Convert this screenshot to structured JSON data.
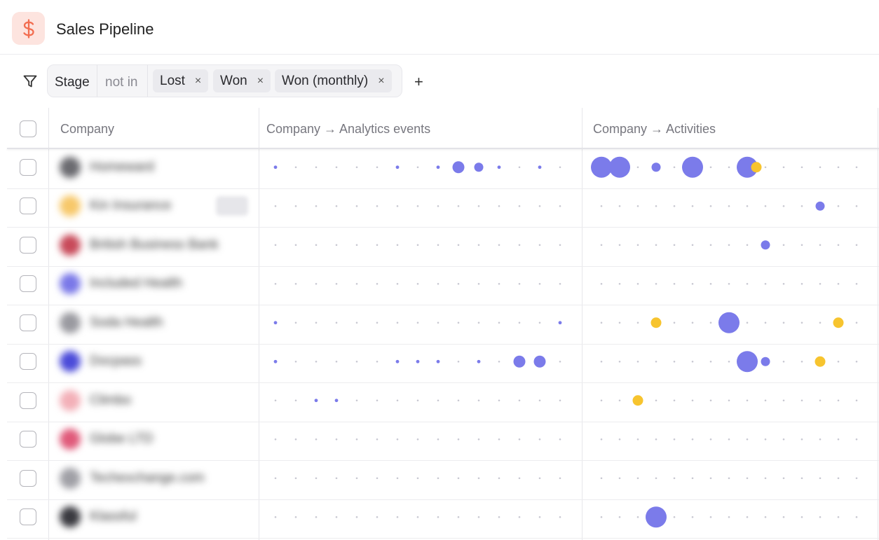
{
  "header": {
    "title": "Sales Pipeline",
    "icon": "dollar-icon",
    "icon_color": "#f26d50"
  },
  "filter": {
    "field": "Stage",
    "operator": "not in",
    "values": [
      "Lost",
      "Won",
      "Won (monthly)"
    ],
    "remove_glyph": "×",
    "add_glyph": "+"
  },
  "table": {
    "columns": [
      "Company",
      "Company → Analytics events",
      "Company → Activities"
    ],
    "rows": [
      {
        "company": "Homeward",
        "logo_color": "#6b6b70",
        "analytics": [
          1,
          0,
          0,
          0,
          0,
          0,
          1,
          0,
          1,
          3,
          2,
          1,
          0,
          1,
          0
        ],
        "activities": [
          {
            "i": 0,
            "s": 4
          },
          {
            "i": 1,
            "s": 4
          },
          {
            "i": 3,
            "s": 2
          },
          {
            "i": 5,
            "s": 4
          },
          {
            "i": 8,
            "s": 4
          },
          {
            "i": 8.5,
            "s": 2,
            "y": 1
          }
        ]
      },
      {
        "company": "Kin Insurance",
        "logo_color": "#f7c86a",
        "tag": true,
        "analytics": [
          0,
          0,
          0,
          0,
          0,
          0,
          0,
          0,
          0,
          0,
          0,
          0,
          0,
          0,
          0
        ],
        "activities": [
          {
            "i": 12,
            "s": 2
          }
        ]
      },
      {
        "company": "British Business Bank",
        "logo_color": "#c84a5a",
        "analytics": [
          0,
          0,
          0,
          0,
          0,
          0,
          0,
          0,
          0,
          0,
          0,
          0,
          0,
          0,
          0
        ],
        "activities": [
          {
            "i": 9,
            "s": 2
          }
        ]
      },
      {
        "company": "Included Health",
        "logo_color": "#7a78e8",
        "analytics": [
          0,
          0,
          0,
          0,
          0,
          0,
          0,
          0,
          0,
          0,
          0,
          0,
          0,
          0,
          0
        ],
        "activities": []
      },
      {
        "company": "Soda Health",
        "logo_color": "#9a9aa0",
        "analytics": [
          1,
          0,
          0,
          0,
          0,
          0,
          0,
          0,
          0,
          0,
          0,
          0,
          0,
          0,
          1
        ],
        "activities": [
          {
            "i": 3,
            "s": 2,
            "y": 1
          },
          {
            "i": 7,
            "s": 4
          },
          {
            "i": 13,
            "s": 2,
            "y": 1
          }
        ]
      },
      {
        "company": "Docpass",
        "logo_color": "#4b4bd9",
        "analytics": [
          1,
          0,
          0,
          0,
          0,
          0,
          1,
          1,
          1,
          0,
          1,
          0,
          3,
          3,
          0
        ],
        "activities": [
          {
            "i": 8,
            "s": 4
          },
          {
            "i": 9,
            "s": 2
          },
          {
            "i": 12,
            "s": 2,
            "y": 1
          }
        ]
      },
      {
        "company": "Climbo",
        "logo_color": "#f3b0b8",
        "analytics": [
          0,
          0,
          1,
          1,
          0,
          0,
          0,
          0,
          0,
          0,
          0,
          0,
          0,
          0,
          0
        ],
        "activities": [
          {
            "i": 2,
            "s": 2,
            "y": 1
          }
        ]
      },
      {
        "company": "Globe LTD",
        "logo_color": "#e05a7a",
        "analytics": [
          0,
          0,
          0,
          0,
          0,
          0,
          0,
          0,
          0,
          0,
          0,
          0,
          0,
          0,
          0
        ],
        "activities": []
      },
      {
        "company": "Techexchange.com",
        "logo_color": "#a0a0a6",
        "analytics": [
          0,
          0,
          0,
          0,
          0,
          0,
          0,
          0,
          0,
          0,
          0,
          0,
          0,
          0,
          0
        ],
        "activities": []
      },
      {
        "company": "Klassful",
        "logo_color": "#3a3a40",
        "analytics": [
          0,
          0,
          0,
          0,
          0,
          0,
          0,
          0,
          0,
          0,
          0,
          0,
          0,
          0,
          0
        ],
        "activities": [
          {
            "i": 3,
            "s": 4
          }
        ]
      }
    ]
  },
  "colors": {
    "accent": "#7b7bea",
    "activity": "#7b7bea",
    "highlight": "#f7c42e",
    "dot": "#c8c8d2"
  }
}
